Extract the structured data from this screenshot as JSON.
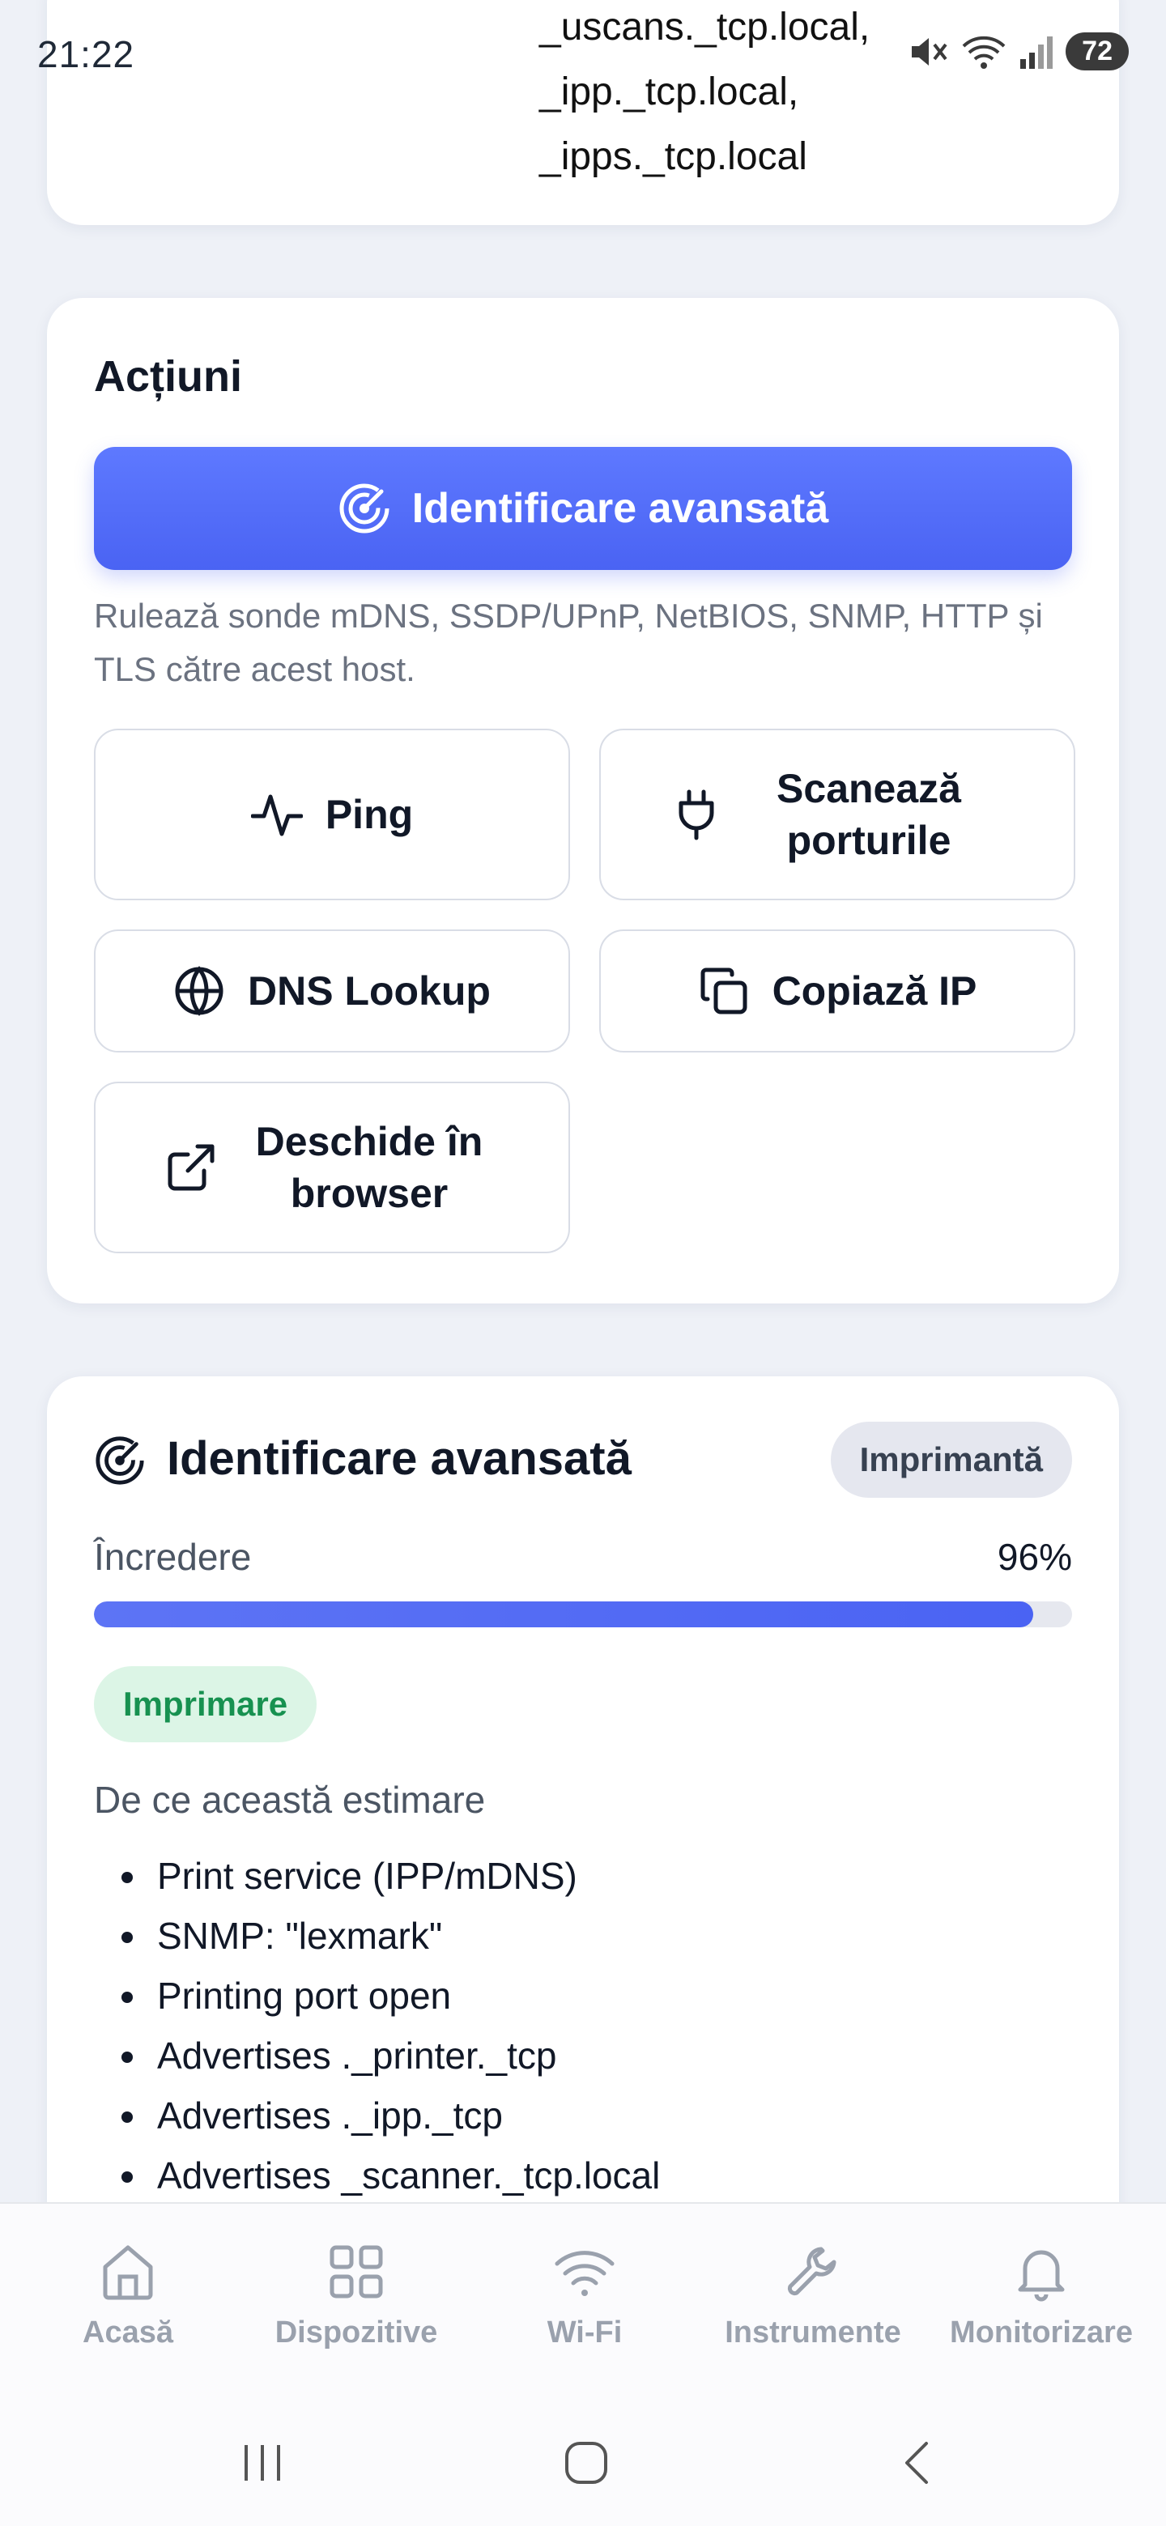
{
  "status_bar": {
    "time": "21:22",
    "battery": "72",
    "icons": [
      "mute-icon",
      "wifi-icon",
      "signal-icon"
    ]
  },
  "mdns_services": [
    "_uscans._tcp.local,",
    "_ipp._tcp.local,",
    "_ipps._tcp.local"
  ],
  "actions": {
    "title": "Acțiuni",
    "primary_button": "Identificare avansată",
    "primary_help": "Rulează sonde mDNS, SSDP/UPnP, NetBIOS, SNMP, HTTP și TLS către acest host.",
    "ping": "Ping",
    "scan_ports": "Scanează porturile",
    "dns_lookup": "DNS Lookup",
    "copy_ip": "Copiază IP",
    "open_browser": "Deschide în browser"
  },
  "identification": {
    "title": "Identificare avansată",
    "device_badge": "Imprimantă",
    "confidence_label": "Încredere",
    "confidence_value": "96%",
    "confidence_percent": 96,
    "category_badge": "Imprimare",
    "why_title": "De ce această estimare",
    "reasons": [
      "Print service (IPP/mDNS)",
      "SNMP: \"lexmark\"",
      "Printing port open",
      "Advertises ._printer._tcp",
      "Advertises ._ipp._tcp",
      "Advertises _scanner._tcp.local"
    ]
  },
  "nav": {
    "items": [
      {
        "label": "Acasă",
        "icon": "home-icon"
      },
      {
        "label": "Dispozitive",
        "icon": "grid-icon"
      },
      {
        "label": "Wi-Fi",
        "icon": "wifi-icon"
      },
      {
        "label": "Instrumente",
        "icon": "wrench-icon"
      },
      {
        "label": "Monitorizare",
        "icon": "bell-icon"
      }
    ]
  },
  "colors": {
    "accent": "#4a63f3",
    "success": "#179150",
    "nav_inactive": "#9aa1ad"
  }
}
